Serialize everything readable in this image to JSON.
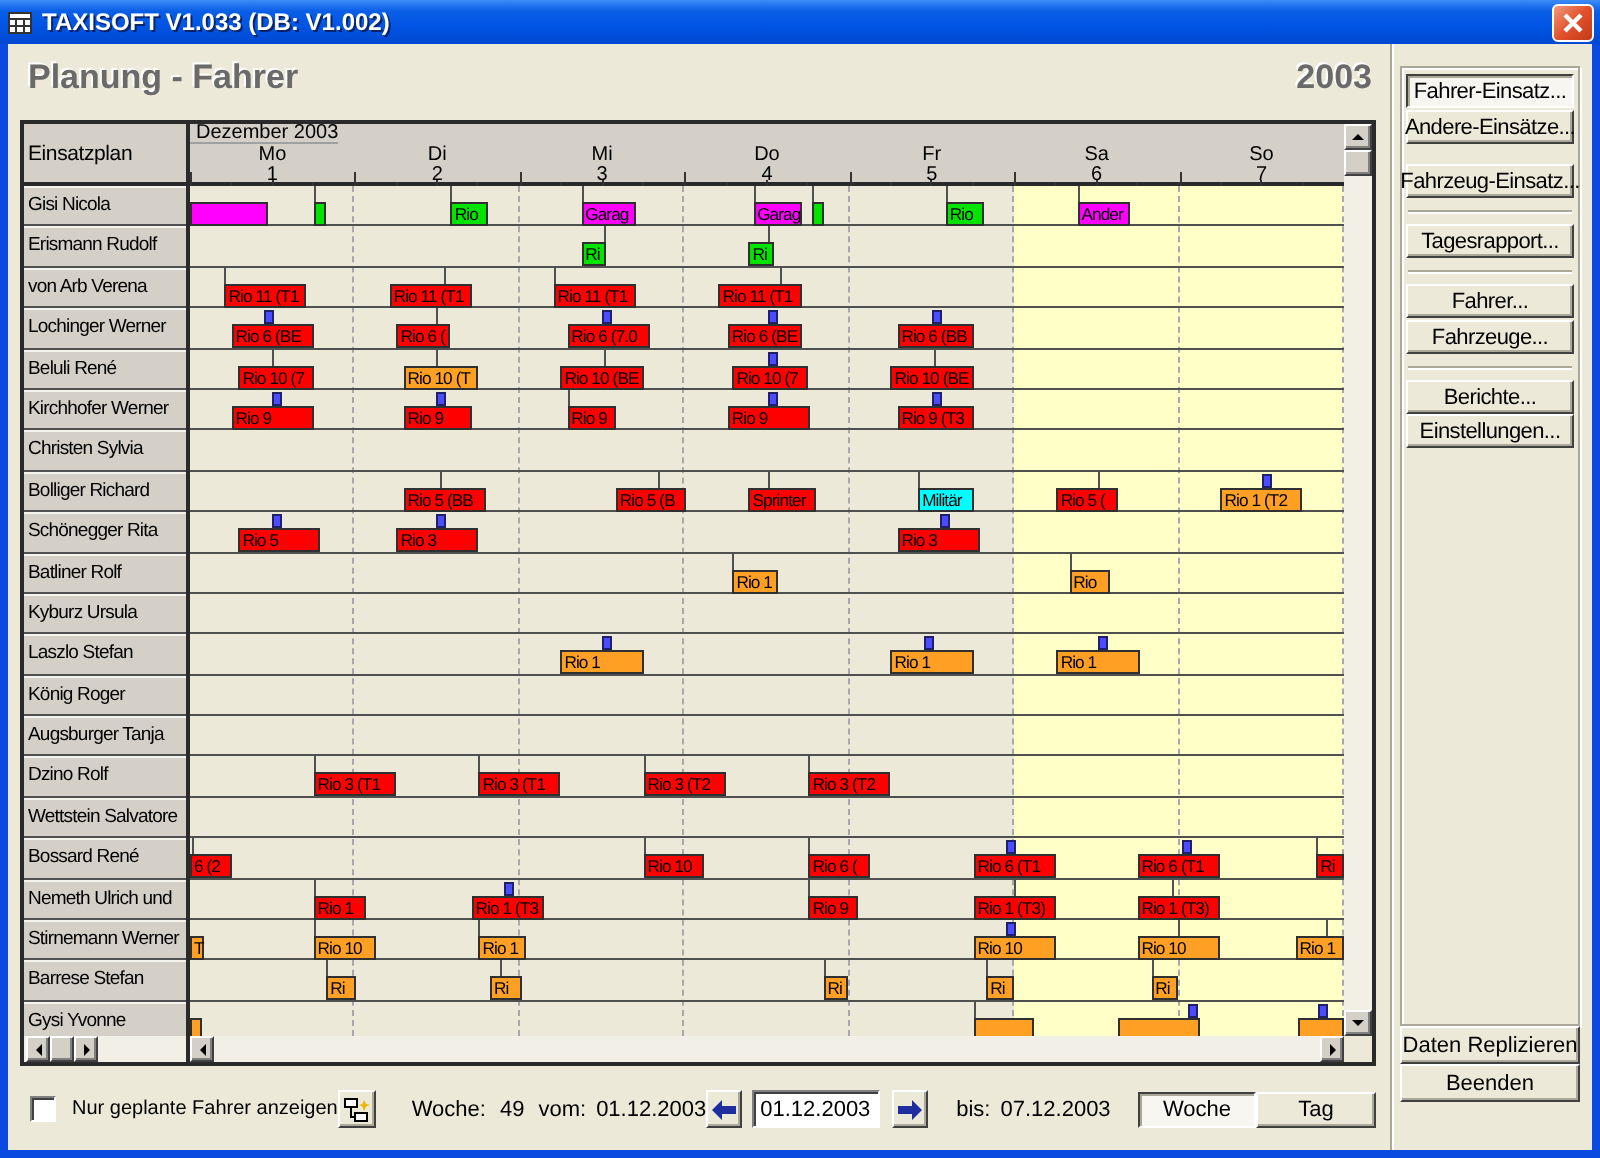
{
  "window": {
    "title": "TAXISOFT V1.033 (DB: V1.002)"
  },
  "heading": {
    "title": "Planung - Fahrer",
    "year": "2003"
  },
  "plan": {
    "corner_label": "Einsatzplan",
    "month": "Dezember 2003",
    "days": [
      {
        "weekday": "Mo",
        "date": "1",
        "weekend": false
      },
      {
        "weekday": "Di",
        "date": "2",
        "weekend": false
      },
      {
        "weekday": "Mi",
        "date": "3",
        "weekend": false
      },
      {
        "weekday": "Do",
        "date": "4",
        "weekend": false
      },
      {
        "weekday": "Fr",
        "date": "5",
        "weekend": false
      },
      {
        "weekday": "Sa",
        "date": "6",
        "weekend": true
      },
      {
        "weekday": "So",
        "date": "7",
        "weekend": true
      }
    ],
    "rows": [
      {
        "name": "Gisi Nicola",
        "bars": [
          {
            "color": "#ff00ff",
            "end": {
              "level": 0.067
            }
          },
          {
            "color": "#00e400",
            "start": {
              "level": 0.107
            },
            "end": {
              "level": 0.118
            },
            "marker": {
              "kind": "line",
              "level": 0.107
            }
          },
          {
            "label": "Rio",
            "color": "#00e400",
            "start": {
              "level": 0.226
            },
            "end": {
              "level": 0.259
            },
            "marker": {
              "kind": "line",
              "level": 0.226
            }
          },
          {
            "label": "Garag",
            "color": "#ff00ff",
            "start": {
              "level": 0.339
            },
            "end": {
              "level": 0.387
            },
            "marker": {
              "kind": "line",
              "level": 0.339
            }
          },
          {
            "label": "Garag",
            "color": "#ff00ff",
            "start": {
              "level": 0.488
            },
            "end": {
              "level": 0.531
            },
            "marker": {
              "kind": "line",
              "level": 0.488
            }
          },
          {
            "color": "#00e400",
            "start": {
              "level": 0.539
            },
            "end": {
              "level": 0.549
            },
            "marker": {
              "kind": "line",
              "level": 0.539
            }
          },
          {
            "label": "Rio",
            "color": "#00e400",
            "start": {
              "level": 0.655
            },
            "end": {
              "level": 0.688
            },
            "marker": {
              "kind": "line",
              "level": 0.655
            }
          },
          {
            "label": "Ander",
            "color": "#ff00ff",
            "start": {
              "level": 0.769
            },
            "end": {
              "level": 0.815
            },
            "marker": {
              "kind": "line",
              "level": 0.769
            }
          }
        ]
      },
      {
        "name": "Erismann Rudolf",
        "bars": [
          {
            "label": "Ri",
            "color": "#00e400",
            "start": {
              "level": 0.339
            },
            "end": {
              "level": 0.36
            },
            "marker": {
              "kind": "line",
              "level": 0.359
            }
          },
          {
            "label": "Ri",
            "color": "#00e400",
            "start": {
              "level": 0.484
            },
            "end": {
              "level": 0.506
            },
            "marker": {
              "kind": "line",
              "level": 0.5
            }
          }
        ]
      },
      {
        "name": "von Arb Verena",
        "bars": [
          {
            "label": "Rio 11 (T1",
            "color": "#ff0000",
            "start": {
              "level": 0.03
            },
            "end": {
              "level": 0.101
            },
            "marker": {
              "kind": "line",
              "level": 0.03
            }
          },
          {
            "label": "Rio 11 (T1",
            "color": "#ff0000",
            "start": {
              "level": 0.173
            },
            "end": {
              "level": 0.244
            },
            "marker": {
              "kind": "line",
              "level": 0.22
            }
          },
          {
            "label": "Rio 11 (T1",
            "color": "#ff0000",
            "start": {
              "level": 0.315
            },
            "end": {
              "level": 0.387
            },
            "marker": {
              "kind": "line",
              "level": 0.315
            }
          },
          {
            "label": "Rio 11 (T1",
            "color": "#ff0000",
            "start": {
              "level": 0.458
            },
            "end": {
              "level": 0.53
            },
            "marker": {
              "kind": "line",
              "level": 0.512
            }
          }
        ]
      },
      {
        "name": "Lochinger Werner",
        "bars": [
          {
            "label": "Rio 6 (BE",
            "color": "#ff0000",
            "start": {
              "level": 0.036
            },
            "end": {
              "level": 0.107
            },
            "marker": {
              "kind": "pin",
              "level": 0.068
            }
          },
          {
            "label": "Rio 6 (",
            "color": "#ff0000",
            "start": {
              "level": 0.179
            },
            "end": {
              "level": 0.226
            },
            "marker": {
              "kind": "line",
              "level": 0.214
            }
          },
          {
            "label": "Rio 6 (7.0",
            "color": "#ff0000",
            "start": {
              "level": 0.327
            },
            "end": {
              "level": 0.399
            },
            "marker": {
              "kind": "pin",
              "level": 0.36
            }
          },
          {
            "label": "Rio 6 (BE",
            "color": "#ff0000",
            "start": {
              "level": 0.466
            },
            "end": {
              "level": 0.53
            },
            "marker": {
              "kind": "pin",
              "level": 0.504
            }
          },
          {
            "label": "Rio 6 (BB",
            "color": "#ff0000",
            "start": {
              "level": 0.613
            },
            "end": {
              "level": 0.68
            },
            "marker": {
              "kind": "pin",
              "level": 0.647
            }
          }
        ]
      },
      {
        "name": "Beluli René",
        "bars": [
          {
            "label": "Rio 10 (7",
            "color": "#ff0000",
            "start": {
              "level": 0.042
            },
            "end": {
              "level": 0.107
            },
            "marker": {
              "kind": "line",
              "level": 0.071
            }
          },
          {
            "label": "Rio 10 (T",
            "color": "#ffa024",
            "start": {
              "level": 0.185
            },
            "end": {
              "level": 0.25
            },
            "marker": {
              "kind": "line",
              "level": 0.214
            }
          },
          {
            "label": "Rio 10 (BE",
            "color": "#ff0000",
            "start": {
              "level": 0.321
            },
            "end": {
              "level": 0.393
            },
            "marker": {
              "kind": "line",
              "level": 0.359
            }
          },
          {
            "label": "Rio 10 (7",
            "color": "#ff0000",
            "start": {
              "level": 0.47
            },
            "end": {
              "level": 0.536
            },
            "marker": {
              "kind": "pin",
              "level": 0.504
            }
          },
          {
            "label": "Rio 10 (BE",
            "color": "#ff0000",
            "start": {
              "level": 0.607
            },
            "end": {
              "level": 0.679
            },
            "marker": {
              "kind": "line",
              "level": 0.644
            }
          }
        ]
      },
      {
        "name": "Kirchhofer Werner",
        "bars": [
          {
            "label": "Rio 9",
            "color": "#ff0000",
            "start": {
              "level": 0.036
            },
            "end": {
              "level": 0.107
            },
            "marker": {
              "kind": "pin",
              "level": 0.074
            }
          },
          {
            "label": "Rio 9",
            "color": "#ff0000",
            "start": {
              "level": 0.185
            },
            "end": {
              "level": 0.244
            },
            "marker": {
              "kind": "pin",
              "level": 0.217
            }
          },
          {
            "label": "Rio 9",
            "color": "#ff0000",
            "start": {
              "level": 0.327
            },
            "end": {
              "level": 0.369
            },
            "marker": {
              "kind": "line",
              "level": 0.327
            }
          },
          {
            "label": "Rio 9",
            "color": "#ff0000",
            "start": {
              "level": 0.466
            },
            "end": {
              "level": 0.537
            },
            "marker": {
              "kind": "pin",
              "level": 0.504
            }
          },
          {
            "label": "Rio 9 (T3",
            "color": "#ff0000",
            "start": {
              "level": 0.613
            },
            "end": {
              "level": 0.68
            },
            "marker": {
              "kind": "pin",
              "level": 0.647
            }
          }
        ]
      },
      {
        "name": "Christen Sylvia",
        "bars": []
      },
      {
        "name": "Bolliger Richard",
        "bars": [
          {
            "label": "Rio 5 (BB",
            "color": "#ff0000",
            "start": {
              "level": 0.185
            },
            "end": {
              "level": 0.256
            },
            "marker": {
              "kind": "line",
              "level": 0.217
            }
          },
          {
            "label": "Rio 5 (B",
            "color": "#ff0000",
            "start": {
              "level": 0.369
            },
            "end": {
              "level": 0.429
            },
            "marker": {
              "kind": "line",
              "level": 0.405
            }
          },
          {
            "label": "Sprinter",
            "color": "#ff0000",
            "start": {
              "level": 0.484
            },
            "end": {
              "level": 0.542
            },
            "marker": {
              "kind": "line",
              "level": 0.5
            }
          },
          {
            "label": "Militär",
            "color": "#00ffff",
            "start": {
              "level": 0.631
            },
            "end": {
              "level": 0.679
            },
            "marker": {
              "kind": "line",
              "level": 0.631
            }
          },
          {
            "label": "Rio 5 (",
            "color": "#ff0000",
            "start": {
              "level": 0.751
            },
            "end": {
              "level": 0.805
            },
            "marker": {
              "kind": "line",
              "level": 0.786
            }
          },
          {
            "label": "Rio 1 (T2",
            "color": "#ffa024",
            "start": {
              "level": 0.893
            },
            "end": {
              "level": 0.964
            },
            "marker": {
              "kind": "pin",
              "level": 0.933
            }
          }
        ]
      },
      {
        "name": "Schönegger Rita",
        "bars": [
          {
            "label": "Rio 5",
            "color": "#ff0000",
            "start": {
              "level": 0.042
            },
            "end": {
              "level": 0.113
            },
            "marker": {
              "kind": "pin",
              "level": 0.074
            }
          },
          {
            "label": "Rio 3",
            "color": "#ff0000",
            "start": {
              "level": 0.179
            },
            "end": {
              "level": 0.25
            },
            "marker": {
              "kind": "pin",
              "level": 0.217
            }
          },
          {
            "label": "Rio 3",
            "color": "#ff0000",
            "start": {
              "level": 0.613
            },
            "end": {
              "level": 0.685
            },
            "marker": {
              "kind": "pin",
              "level": 0.653
            }
          }
        ]
      },
      {
        "name": "Batliner Rolf",
        "bars": [
          {
            "label": "Rio 1",
            "color": "#ffa024",
            "start": {
              "level": 0.47
            },
            "end": {
              "level": 0.51
            },
            "marker": {
              "kind": "line",
              "level": 0.47
            }
          },
          {
            "label": "Rio",
            "color": "#ffa024",
            "start": {
              "level": 0.762
            },
            "end": {
              "level": 0.798
            },
            "marker": {
              "kind": "line",
              "level": 0.762
            }
          }
        ]
      },
      {
        "name": "Kyburz Ursula",
        "bars": []
      },
      {
        "name": "Laszlo Stefan",
        "bars": [
          {
            "label": "Rio 1",
            "color": "#ffa024",
            "start": {
              "level": 0.321
            },
            "end": {
              "level": 0.393
            },
            "marker": {
              "kind": "pin",
              "level": 0.36
            }
          },
          {
            "label": "Rio 1",
            "color": "#ffa024",
            "start": {
              "level": 0.607
            },
            "end": {
              "level": 0.679
            },
            "marker": {
              "kind": "pin",
              "level": 0.64
            }
          },
          {
            "label": "Rio 1",
            "color": "#ffa024",
            "start": {
              "level": 0.751
            },
            "end": {
              "level": 0.823
            },
            "marker": {
              "kind": "pin",
              "level": 0.79
            }
          }
        ]
      },
      {
        "name": "König Roger",
        "bars": []
      },
      {
        "name": "Augsburger Tanja",
        "bars": []
      },
      {
        "name": "Dzino Rolf",
        "bars": [
          {
            "label": "Rio 3 (T1",
            "color": "#ff0000",
            "start": {
              "level": 0.107
            },
            "end": {
              "level": 0.179
            },
            "marker": {
              "kind": "line",
              "level": 0.107
            }
          },
          {
            "label": "Rio 3 (T1",
            "color": "#ff0000",
            "start": {
              "level": 0.25
            },
            "end": {
              "level": 0.321
            },
            "marker": {
              "kind": "line",
              "level": 0.25
            }
          },
          {
            "label": "Rio 3 (T2",
            "color": "#ff0000",
            "start": {
              "level": 0.393
            },
            "end": {
              "level": 0.464
            },
            "marker": {
              "kind": "line",
              "level": 0.393
            }
          },
          {
            "label": "Rio 3 (T2",
            "color": "#ff0000",
            "start": {
              "level": 0.536
            },
            "end": {
              "level": 0.607
            },
            "marker": {
              "kind": "line",
              "level": 0.536
            }
          }
        ]
      },
      {
        "name": "Wettstein Salvatore",
        "bars": []
      },
      {
        "name": "Bossard René",
        "bars": [
          {
            "label": "6 (2",
            "color": "#ff0000",
            "end": {
              "level": 0.036
            },
            "marker": {
              "kind": "line",
              "level": 0.001
            }
          },
          {
            "label": "Rio 10",
            "color": "#ff0000",
            "start": {
              "level": 0.393
            },
            "end": {
              "level": 0.446
            },
            "marker": {
              "kind": "line",
              "level": 0.393
            }
          },
          {
            "label": "Rio 6 (",
            "color": "#ff0000",
            "start": {
              "level": 0.536
            },
            "end": {
              "level": 0.589
            },
            "marker": {
              "kind": "line",
              "level": 0.536
            }
          },
          {
            "label": "Rio 6 (T1",
            "color": "#ff0000",
            "start": {
              "level": 0.679
            },
            "end": {
              "level": 0.75
            },
            "marker": {
              "kind": "pin",
              "level": 0.711
            }
          },
          {
            "label": "Rio 6 (T1",
            "color": "#ff0000",
            "start": {
              "level": 0.821
            },
            "end": {
              "level": 0.893
            },
            "marker": {
              "kind": "pin",
              "level": 0.863
            }
          },
          {
            "label": "Ri",
            "color": "#ff0000",
            "start": {
              "level": 0.976
            },
            "end": {
              "level": 1
            },
            "marker": {
              "kind": "line",
              "level": 0.976
            }
          }
        ]
      },
      {
        "name": "Nemeth Ulrich und",
        "bars": [
          {
            "label": "Rio 1",
            "color": "#ff0000",
            "start": {
              "level": 0.107
            },
            "end": {
              "level": 0.152
            },
            "marker": {
              "kind": "line",
              "level": 0.107
            }
          },
          {
            "label": "Rio 1 (T3",
            "color": "#ff0000",
            "start": {
              "level": 0.244
            },
            "end": {
              "level": 0.307
            },
            "marker": {
              "kind": "pin",
              "level": 0.275
            }
          },
          {
            "label": "Rio 9",
            "color": "#ff0000",
            "start": {
              "level": 0.536
            },
            "end": {
              "level": 0.579
            },
            "marker": {
              "kind": "line",
              "level": 0.536
            }
          },
          {
            "label": "Rio 1 (T3)",
            "color": "#ff0000",
            "start": {
              "level": 0.679
            },
            "end": {
              "level": 0.75
            },
            "marker": {
              "kind": "line",
              "level": 0.714
            }
          },
          {
            "label": "Rio 1 (T3)",
            "color": "#ff0000",
            "start": {
              "level": 0.821
            },
            "end": {
              "level": 0.893
            },
            "marker": {
              "kind": "line",
              "level": 0.851
            }
          }
        ]
      },
      {
        "name": "Stirnemann Werner",
        "bars": [
          {
            "label": "T",
            "color": "#ffa024",
            "end": {
              "level": 0.012
            }
          },
          {
            "label": "Rio 10",
            "color": "#ffa024",
            "start": {
              "level": 0.107
            },
            "end": {
              "level": 0.161
            },
            "marker": {
              "kind": "line",
              "level": 0.107
            }
          },
          {
            "label": "Rio 1",
            "color": "#ffa024",
            "start": {
              "level": 0.25
            },
            "end": {
              "level": 0.292
            },
            "marker": {
              "kind": "line",
              "level": 0.25
            }
          },
          {
            "label": "Rio 10",
            "color": "#ffa024",
            "start": {
              "level": 0.679
            },
            "end": {
              "level": 0.75
            },
            "marker": {
              "kind": "pin",
              "level": 0.711
            }
          },
          {
            "label": "Rio 10",
            "color": "#ffa024",
            "start": {
              "level": 0.821
            },
            "end": {
              "level": 0.893
            },
            "marker": {
              "kind": "line",
              "level": 0.857
            }
          },
          {
            "label": "Rio 1",
            "color": "#ffa024",
            "start": {
              "level": 0.958
            },
            "end": {
              "level": 1
            },
            "marker": {
              "kind": "line",
              "level": 0.984
            }
          }
        ]
      },
      {
        "name": "Barrese Stefan",
        "bars": [
          {
            "label": "Ri",
            "color": "#ffa024",
            "start": {
              "level": 0.118
            },
            "end": {
              "level": 0.143
            },
            "marker": {
              "kind": "line",
              "level": 0.118
            }
          },
          {
            "label": "Ri",
            "color": "#ffa024",
            "start": {
              "level": 0.26
            },
            "end": {
              "level": 0.287
            },
            "marker": {
              "kind": "line",
              "level": 0.268
            }
          },
          {
            "label": "Ri",
            "color": "#ffa024",
            "start": {
              "level": 0.549
            },
            "end": {
              "level": 0.571
            },
            "marker": {
              "kind": "line",
              "level": 0.549
            }
          },
          {
            "label": "Ri",
            "color": "#ffa024",
            "start": {
              "level": 0.69
            },
            "end": {
              "level": 0.714
            },
            "marker": {
              "kind": "line",
              "level": 0.69
            }
          },
          {
            "label": "Ri",
            "color": "#ffa024",
            "start": {
              "level": 0.833
            },
            "end": {
              "level": 0.857
            },
            "marker": {
              "kind": "line",
              "level": 0.833
            }
          }
        ]
      },
      {
        "name": "Gysi Yvonne",
        "bars": [
          {
            "color": "#ffa024",
            "end": {
              "level": 0.01
            }
          },
          {
            "color": "#ffa024",
            "start": {
              "level": 0.679
            },
            "end": {
              "level": 0.732
            },
            "marker": {
              "kind": "line",
              "level": 0.679
            }
          },
          {
            "color": "#ffa024",
            "start": {
              "level": 0.805
            },
            "end": {
              "level": 0.876
            },
            "marker": {
              "kind": "pin",
              "level": 0.868
            }
          },
          {
            "color": "#ffa024",
            "start": {
              "level": 0.96
            },
            "end": {
              "level": 1
            },
            "marker": {
              "kind": "pin",
              "level": 0.981
            }
          }
        ]
      }
    ]
  },
  "side_panel": {
    "groups": [
      {
        "divider": false,
        "buttons": [
          {
            "label": "Fahrer-Einsatz...",
            "selected": true
          },
          {
            "label": "Andere-Einsätze...",
            "selected": false
          }
        ]
      },
      {
        "divider": false,
        "buttons": [
          {
            "label": "Fahrzeug-Einsatz...",
            "selected": false
          }
        ]
      },
      {
        "divider": true,
        "buttons": [
          {
            "label": "Tagesrapport...",
            "selected": false
          }
        ]
      },
      {
        "divider": true,
        "buttons": [
          {
            "label": "Fahrer...",
            "selected": false
          },
          {
            "label": "Fahrzeuge...",
            "selected": false
          }
        ]
      },
      {
        "divider": true,
        "buttons": [
          {
            "label": "Berichte...",
            "selected": false
          }
        ]
      }
    ],
    "settings_button": "Einstellungen...",
    "buttons": [
      "Daten Replizieren",
      "Beenden"
    ]
  },
  "footer": {
    "checkbox": {
      "label": "Nur geplante Fahrer anzeigen",
      "checked": false
    },
    "week_label": "Woche:",
    "week": "49",
    "from_label": "vom:",
    "from": "01.12.2003",
    "date_field": "01.12.2003",
    "to_label": "bis:",
    "to": "07.12.2003",
    "views": [
      {
        "label": "Woche",
        "selected": true
      },
      {
        "label": "Tag",
        "selected": false
      }
    ]
  }
}
